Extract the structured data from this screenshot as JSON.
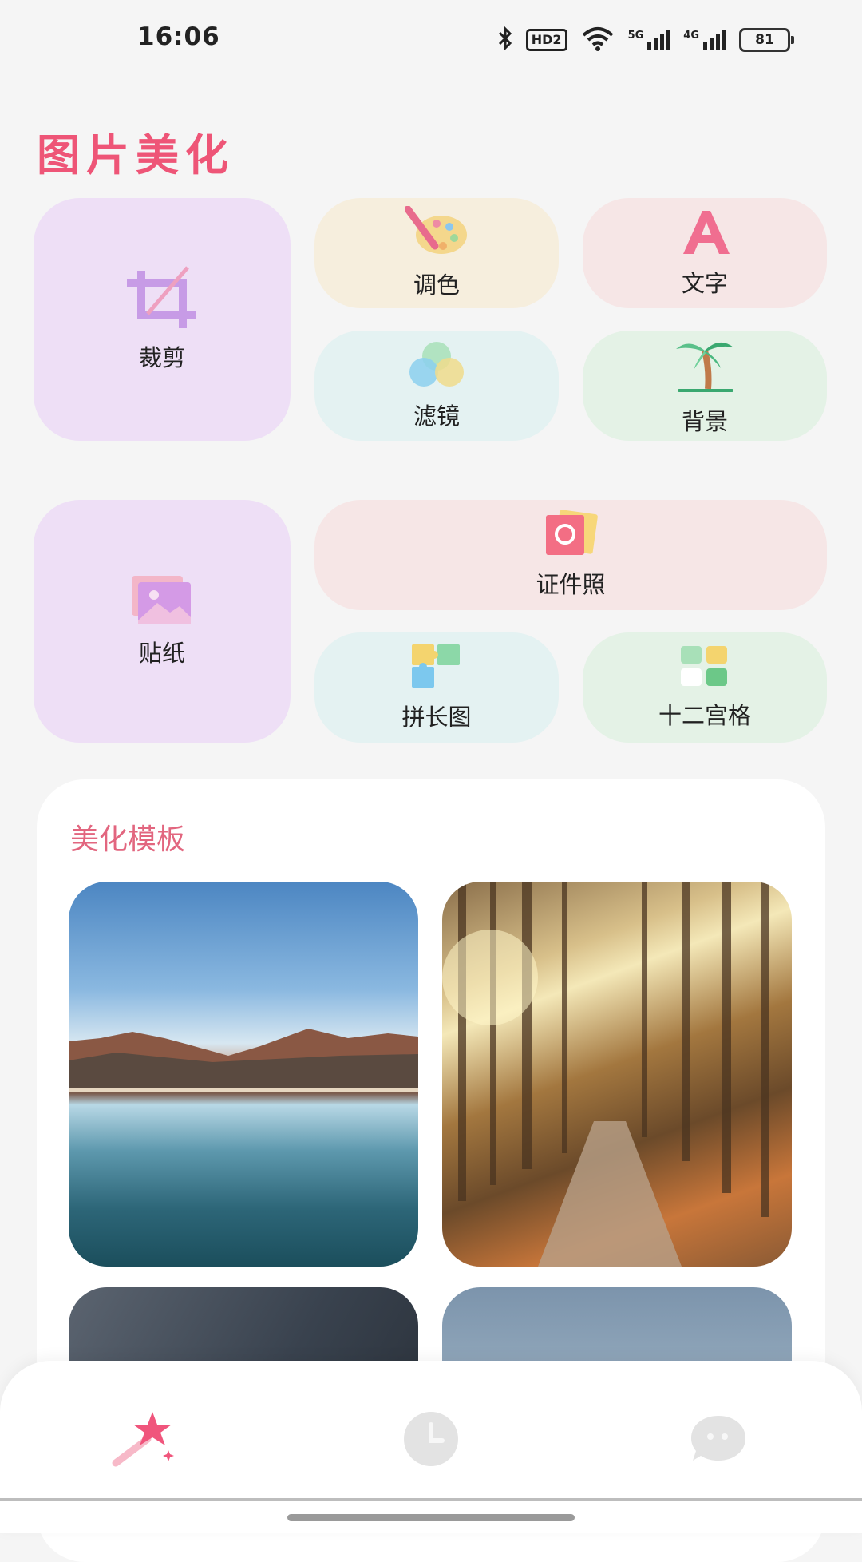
{
  "status_bar": {
    "time": "16:06",
    "hd_label": "HD2",
    "sig1_label": "5G",
    "sig2_label": "4G",
    "battery": "81"
  },
  "page_title": "图片美化",
  "tools": {
    "crop": "裁剪",
    "color": "调色",
    "text": "文字",
    "filter": "滤镜",
    "background": "背景",
    "sticker": "贴纸",
    "id_photo": "证件照",
    "long_stitch": "拼长图",
    "nine_grid": "十二宫格"
  },
  "templates": {
    "title": "美化模板"
  },
  "colors": {
    "accent": "#ee5577",
    "template_title": "#e2667f"
  },
  "bottom_nav": {
    "items": [
      "magic-wand-star-icon",
      "clock-icon",
      "chat-icon"
    ],
    "active": 0
  }
}
